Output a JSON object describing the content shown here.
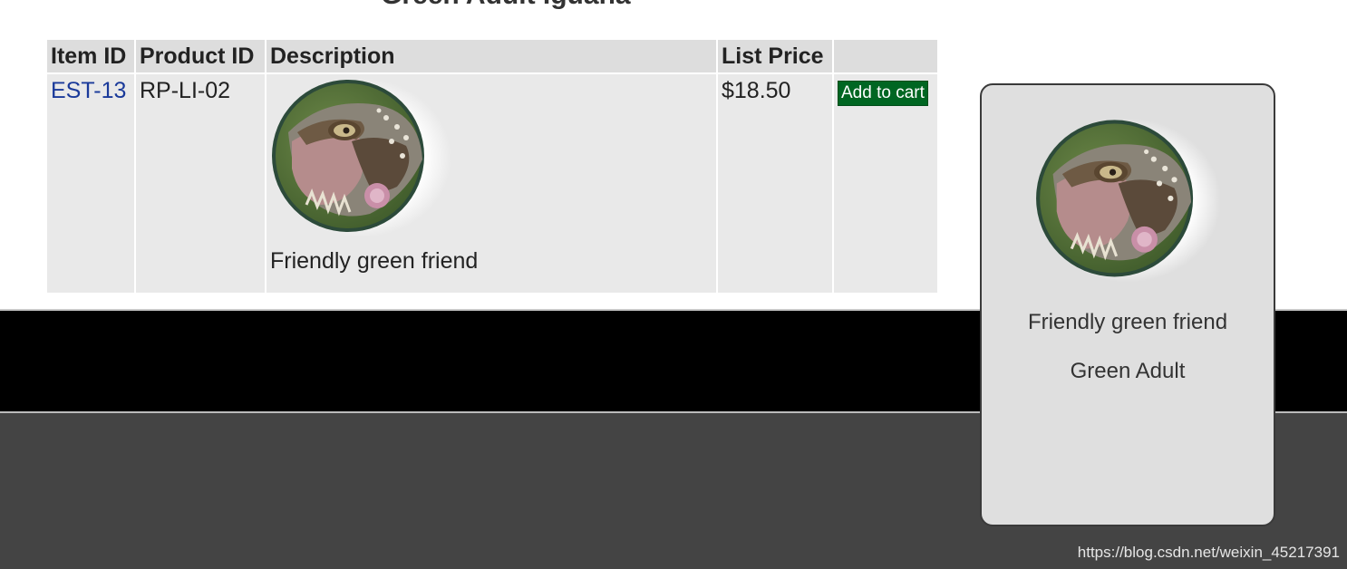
{
  "page": {
    "heading": "Green Adult Iguana"
  },
  "table": {
    "headers": {
      "item_id": "Item ID",
      "product_id": "Product ID",
      "description": "Description",
      "list_price": "List Price",
      "action": ""
    },
    "rows": [
      {
        "item_id": "EST-13",
        "product_id": "RP-LI-02",
        "image": "iguana-photo",
        "description": "Friendly green friend",
        "list_price": "$18.50",
        "action_label": "Add to cart"
      }
    ]
  },
  "popup": {
    "image": "iguana-photo",
    "description": "Friendly green friend",
    "attribute": "Green Adult"
  },
  "footer": {
    "watermark": "https://blog.csdn.net/weixin_45217391"
  },
  "colors": {
    "link": "#1a3a9a",
    "add_button_bg": "#006622",
    "header_bg": "#dddddd",
    "cell_bg": "#e9e9e9",
    "footer_top": "#000000",
    "footer_bottom": "#444444",
    "popup_bg": "#dfdfdf"
  }
}
